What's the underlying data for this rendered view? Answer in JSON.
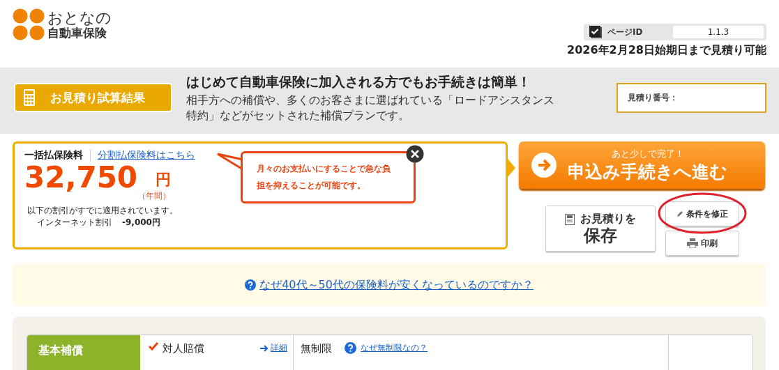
{
  "logo": {
    "line1": "おとなの",
    "line2": "自動車保険"
  },
  "page_id": {
    "label": "ページID",
    "value": "1.1.3"
  },
  "deadline": "2026年2月28日始期日まで見積り可能",
  "banner": {
    "badge": "お見積り試算結果",
    "headline": "はじめて自動車保険に加入される方でもお手続きは簡単！",
    "description": "相手方への補償や、多くのお客さまに選ばれている「ロードアシスタンス特約」などがセットされた補償プランです。",
    "quote_number_label": "見積り番号："
  },
  "price": {
    "tab_label": "一括払保険料",
    "installment_link": "分割払保険料はこちら",
    "amount": "32,750",
    "unit": "円",
    "period": "（年間）",
    "discount_note": "以下の割引がすでに適用されています。",
    "discounts": [
      {
        "name": "インターネット割引",
        "amount": "-9,000円"
      }
    ]
  },
  "tooltip": {
    "text": "月々のお支払いにすることで急な負担を抑えることが可能です。"
  },
  "apply_button": {
    "caption": "あと少しで完了！",
    "label": "申込み手続きへ進む"
  },
  "save_button": {
    "line1": "お見積りを",
    "line2": "保存"
  },
  "edit_button": {
    "label": "条件を修正",
    "highlighted": true
  },
  "print_button": {
    "label": "印刷"
  },
  "age_link": "なぜ40代～50代の保険料が安くなっているのですか？",
  "coverage": {
    "section": "基本補償",
    "rows": [
      {
        "name": "対人賠償",
        "detail_link": "詳細",
        "value": "無制限",
        "help_link": "なぜ無制限なの？"
      }
    ]
  }
}
